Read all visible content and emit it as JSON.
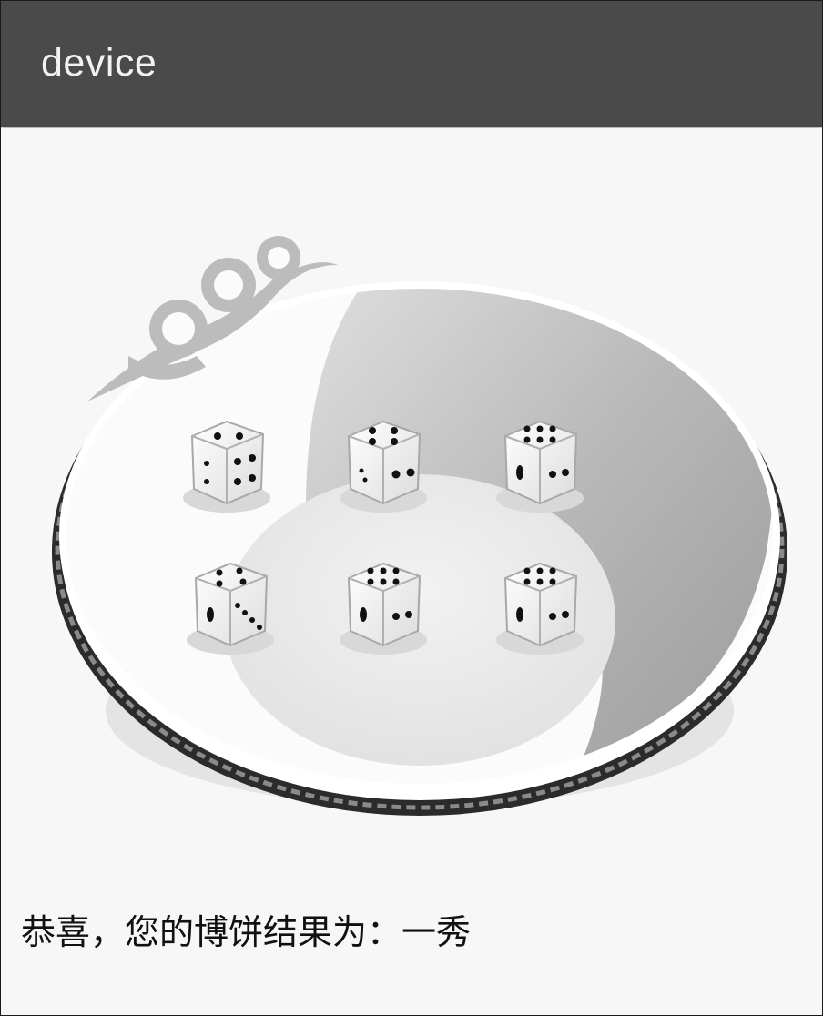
{
  "app_bar": {
    "title": "device"
  },
  "bowl": {
    "icon": "dice-bowl",
    "decoration_icon": "cloud-scroll-pattern"
  },
  "dice": [
    {
      "icon": "dice-four-face"
    },
    {
      "icon": "dice-four-face"
    },
    {
      "icon": "dice-six-face"
    },
    {
      "icon": "dice-four-face"
    },
    {
      "icon": "dice-six-face"
    },
    {
      "icon": "dice-six-face"
    }
  ],
  "result": {
    "text": "恭喜，您的博饼结果为：一秀"
  },
  "colors": {
    "app_bar": "#4a4a4a",
    "background": "#f7f7f7",
    "bowl_dark": "#2a2a2a",
    "bowl_inner_gray": "#b4b4b4"
  }
}
